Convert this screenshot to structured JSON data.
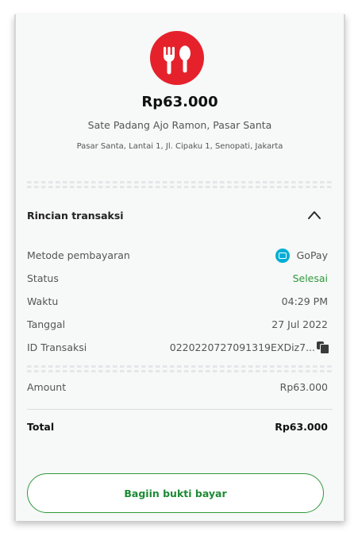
{
  "receipt": {
    "logo_icon": "fork-spoon-icon",
    "logo_color": "#e5222b",
    "amount": "Rp63.000",
    "merchant_name": "Sate Padang Ajo Ramon, Pasar Santa",
    "merchant_address": "Pasar Santa, Lantai 1, Jl. Cipaku 1, Senopati, Jakarta"
  },
  "details": {
    "title": "Rincian transaksi",
    "toggle_icon": "chevron-up-icon",
    "rows": [
      {
        "label": "Metode pembayaran",
        "value": "GoPay",
        "icon": "gopay-icon"
      },
      {
        "label": "Status",
        "value": "Selesai",
        "value_color": "#2e9a3a"
      },
      {
        "label": "Waktu",
        "value": "04:29 PM"
      },
      {
        "label": "Tanggal",
        "value": "27 Jul 2022"
      },
      {
        "label": "ID Transaksi",
        "value": "0220220727091319EXDiz7...",
        "icon": "copy-icon"
      }
    ],
    "amount_label": "Amount",
    "amount_value": "Rp63.000",
    "total_label": "Total",
    "total_value": "Rp63.000"
  },
  "actions": {
    "share_label": "Bagiin bukti bayar",
    "accent_color": "#2e9a3a"
  }
}
